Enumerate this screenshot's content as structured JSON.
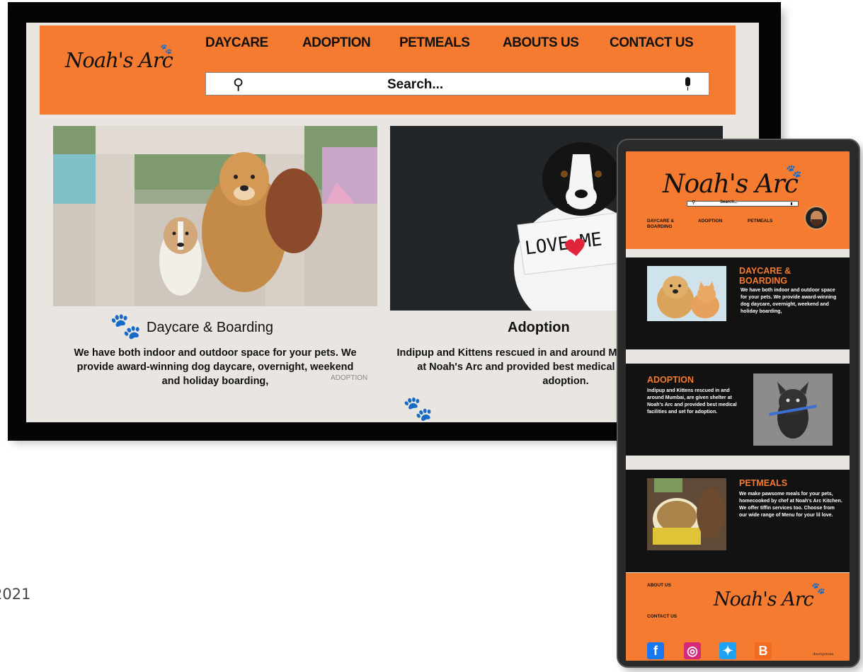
{
  "desktop": {
    "brand": "Noah's Arc",
    "nav": [
      "DAYCARE",
      "ADOPTION",
      "PETMEALS",
      "ABOUTS US",
      "CONTACT US"
    ],
    "search_placeholder": "Search...",
    "cards": [
      {
        "title": "Daycare & Boarding",
        "body": "We have both indoor and outdoor space for your pets. We provide award-winning dog daycare, overnight, weekend and holiday boarding,"
      },
      {
        "title": "Adoption",
        "body": "Indipup and Kittens rescued in and  around Mumbai, are given shelter at Noah's Arc and provided best medical facilities and set for adoption."
      }
    ],
    "overlay_label": "ADOPTION",
    "image1_alt": "dogs",
    "image2_sign": "LOVE ME"
  },
  "mobile": {
    "brand": "Noah's Arc",
    "search_placeholder": "Search...",
    "nav": [
      "DAYCARE & BOARDING",
      "ADOPTION",
      "PETMEALS"
    ],
    "sections": [
      {
        "heading": "DAYCARE & BOARDING",
        "body": "We have both indoor and outdoor space for your pets. We provide award-winning dog daycare, overnight, weekend and holiday boarding,"
      },
      {
        "heading": "ADOPTION",
        "body": "Indipup and Kittens rescued in and  around Mumbai, are given shelter at Noah's Arc and provided best medical facilities and set for adoption."
      },
      {
        "heading": "PETMEALS",
        "body": "We make pawsome meals for your pets, homecooked by chef at Noah's Arc Kitchen. We offer tiffin services too. Choose from our wide range of Menu for your lil love."
      }
    ],
    "footer": {
      "links": [
        "ABOUT US",
        "CONTACT US"
      ],
      "brand": "Noah's Arc",
      "social": [
        {
          "icon": "facebook-icon",
          "glyph": "f",
          "color": "#1877f2"
        },
        {
          "icon": "instagram-icon",
          "glyph": "◎",
          "color": "#d6297a"
        },
        {
          "icon": "twitter-icon",
          "glyph": "✦",
          "color": "#1da1f2"
        },
        {
          "icon": "blogger-icon",
          "glyph": "B",
          "color": "#f26b21"
        }
      ],
      "signature": "Anonymous"
    }
  },
  "caption_year": "2021",
  "colors": {
    "brand_orange": "#f47b2f",
    "background": "#e9e5e1",
    "dark": "#121212"
  }
}
